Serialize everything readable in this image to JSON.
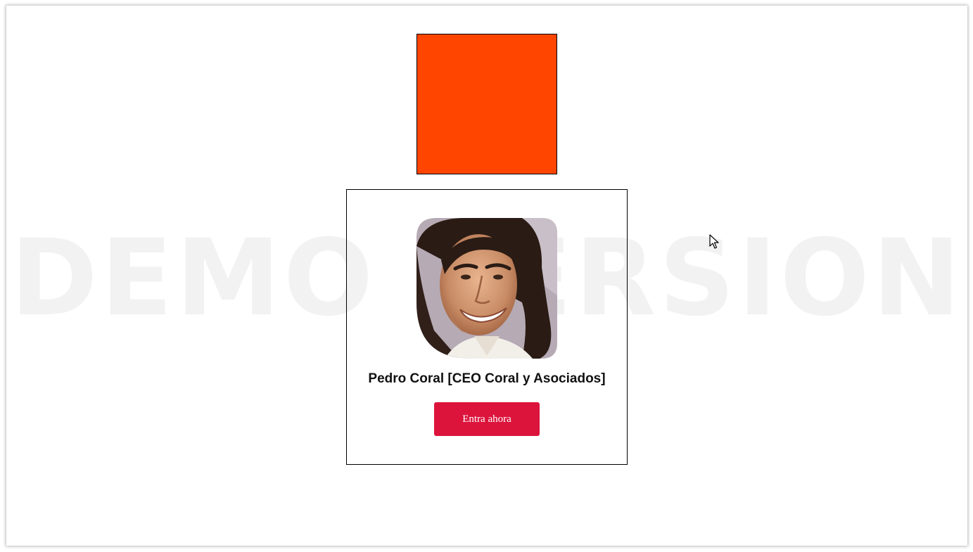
{
  "watermark": {
    "text": "DEMO VERSION"
  },
  "colors": {
    "square": "#ff4500",
    "button": "#dc143c",
    "watermark": "#f2f2f3"
  },
  "profile": {
    "name": "Pedro Coral [CEO Coral y Asociados]",
    "avatar": "profile-photo",
    "cta_label": "Entra ahora"
  },
  "cursor": {
    "icon": "mouse-pointer-icon"
  }
}
